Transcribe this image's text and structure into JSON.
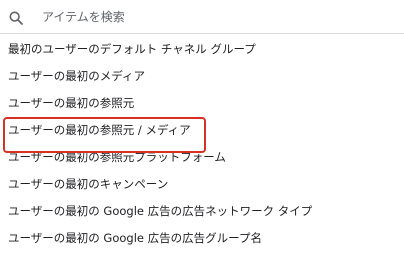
{
  "search": {
    "placeholder": "アイテムを検索",
    "icon": "search-icon"
  },
  "items": [
    {
      "label": "最初のユーザーのデフォルト チャネル グループ"
    },
    {
      "label": "ユーザーの最初のメディア"
    },
    {
      "label": "ユーザーの最初の参照元"
    },
    {
      "label": "ユーザーの最初の参照元 / メディア",
      "highlighted": true
    },
    {
      "label": "ユーザーの最初の参照元プラットフォーム"
    },
    {
      "label": "ユーザーの最初のキャンペーン"
    },
    {
      "label": "ユーザーの最初の Google 広告の広告ネットワーク タイプ"
    },
    {
      "label": "ユーザーの最初の Google 広告の広告グループ名"
    }
  ],
  "colors": {
    "highlight_border": "#d93025",
    "text": "#202124",
    "placeholder": "#5f6368"
  }
}
